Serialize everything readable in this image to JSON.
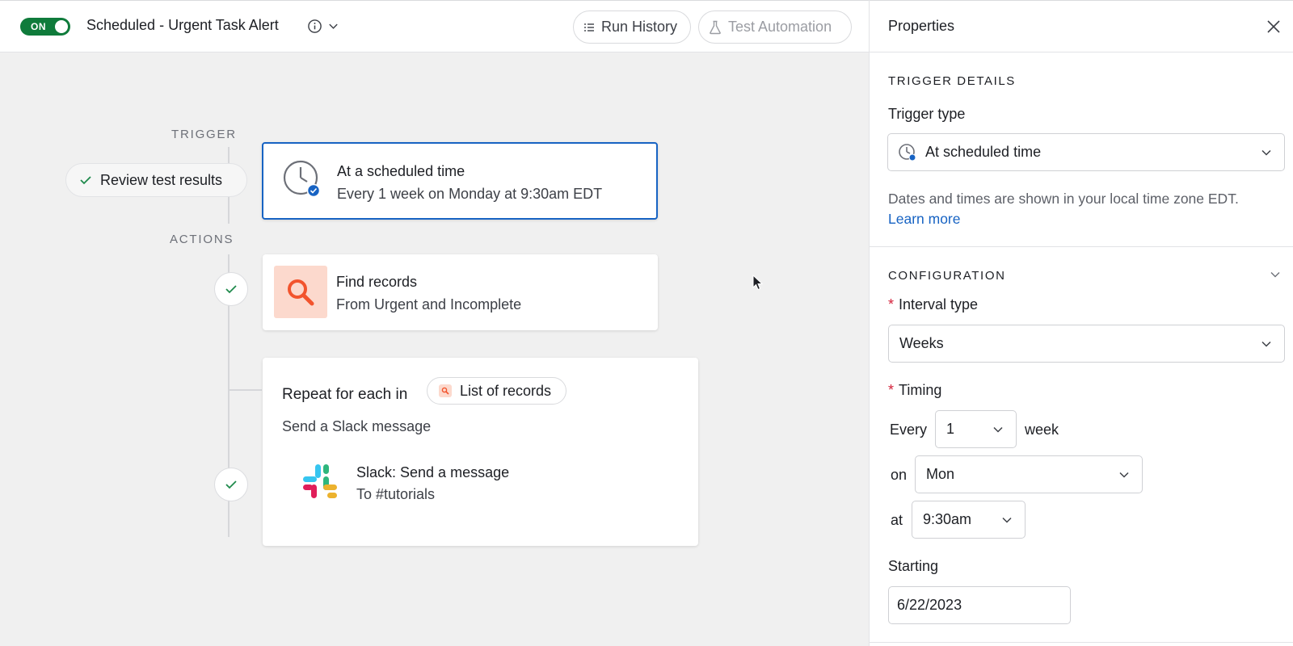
{
  "header": {
    "toggle_label": "ON",
    "automation_title": "Scheduled - Urgent Task Alert",
    "run_history_label": "Run History",
    "test_automation_label": "Test Automation"
  },
  "canvas": {
    "trigger_section": "TRIGGER",
    "actions_section": "ACTIONS",
    "review_label": "Review test results",
    "trigger_card": {
      "title": "At a scheduled time",
      "subtitle": "Every 1 week on Monday at 9:30am EDT"
    },
    "find_card": {
      "title": "Find records",
      "subtitle": "From Urgent and Incomplete"
    },
    "repeat_card": {
      "title": "Repeat for each in",
      "chip_label": "List of records",
      "description": "Send a Slack message",
      "slack_title": "Slack: Send a message",
      "slack_subtitle": "To #tutorials"
    }
  },
  "panel": {
    "title": "Properties",
    "trigger_details_heading": "TRIGGER DETAILS",
    "trigger_type_label": "Trigger type",
    "trigger_type_value": "At scheduled time",
    "help_text": "Dates and times are shown in your local time zone EDT.",
    "learn_more": "Learn more",
    "configuration_heading": "CONFIGURATION",
    "interval_type_label": "Interval type",
    "interval_type_value": "Weeks",
    "timing_label": "Timing",
    "every_label": "Every",
    "every_value": "1",
    "unit_label": "week",
    "on_label": "on",
    "day_value": "Mon",
    "at_label": "at",
    "time_value": "9:30am",
    "starting_label": "Starting",
    "starting_value": "6/22/2023",
    "required_marker": "*"
  },
  "colors": {
    "toggle_on": "#0f7b3b",
    "selected_border": "#1763c3",
    "link": "#1763c3",
    "required": "#d4213a",
    "search_tile": "#fcd9cd",
    "canvas_bg": "#f0f0f0"
  },
  "icons": [
    "info-icon",
    "chevron-down-icon",
    "run-history-icon",
    "flask-icon",
    "close-icon",
    "check-icon",
    "clock-icon",
    "search-icon",
    "slack-icon",
    "cursor-icon"
  ]
}
